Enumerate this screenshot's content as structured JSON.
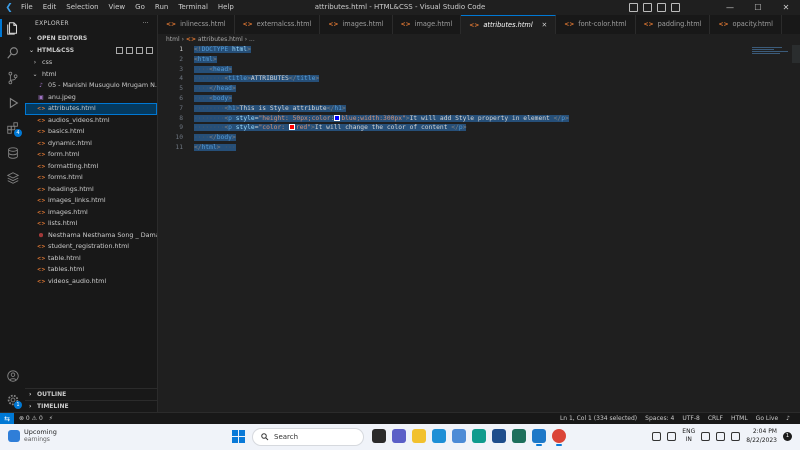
{
  "window": {
    "title": "attributes.html - HTML&CSS - Visual Studio Code",
    "menu": [
      "File",
      "Edit",
      "Selection",
      "View",
      "Go",
      "Run",
      "Terminal",
      "Help"
    ],
    "controls": {
      "minimize": "—",
      "maximize": "☐",
      "close": "✕"
    }
  },
  "sidebar": {
    "header": "EXPLORER",
    "more": "···",
    "open_editors": "OPEN EDITORS",
    "workspace": "HTML&CSS",
    "tree": [
      {
        "label": "css",
        "kind": "folder",
        "chevron": "›",
        "indent": 1
      },
      {
        "label": "html",
        "kind": "folder",
        "chevron": "⌄",
        "indent": 1
      },
      {
        "label": "05 - Manishi Musugulo Mrugam N...",
        "kind": "audio",
        "indent": 2
      },
      {
        "label": "anu.jpeg",
        "kind": "img",
        "indent": 2
      },
      {
        "label": "attributes.html",
        "kind": "html",
        "indent": 2,
        "selected": true
      },
      {
        "label": "audios_videos.html",
        "kind": "html",
        "indent": 2
      },
      {
        "label": "basics.html",
        "kind": "html",
        "indent": 2
      },
      {
        "label": "dynamic.html",
        "kind": "html",
        "indent": 2
      },
      {
        "label": "form.html",
        "kind": "html",
        "indent": 2
      },
      {
        "label": "formatting.html",
        "kind": "html",
        "indent": 2
      },
      {
        "label": "forms.html",
        "kind": "html",
        "indent": 2
      },
      {
        "label": "headings.html",
        "kind": "html",
        "indent": 2
      },
      {
        "label": "images_links.html",
        "kind": "html",
        "indent": 2
      },
      {
        "label": "images.html",
        "kind": "html",
        "indent": 2
      },
      {
        "label": "lists.html",
        "kind": "html",
        "indent": 2
      },
      {
        "label": "Nesthama Nesthama Song _ Damar...",
        "kind": "err",
        "indent": 2
      },
      {
        "label": "student_registration.html",
        "kind": "html",
        "indent": 2
      },
      {
        "label": "table.html",
        "kind": "html",
        "indent": 2
      },
      {
        "label": "tables.html",
        "kind": "html",
        "indent": 2
      },
      {
        "label": "videos_audio.html",
        "kind": "html",
        "indent": 2
      }
    ],
    "outline": "OUTLINE",
    "timeline": "TIMELINE"
  },
  "tabs": [
    {
      "label": "inlinecss.html"
    },
    {
      "label": "externalcss.html"
    },
    {
      "label": "images.html"
    },
    {
      "label": "image.html"
    },
    {
      "label": "attributes.html",
      "active": true,
      "close": "✕"
    },
    {
      "label": "font-color.html"
    },
    {
      "label": "padding.html"
    },
    {
      "label": "opacity.html"
    }
  ],
  "breadcrumb": {
    "folder": "html",
    "sep": "›",
    "icon": "<>",
    "file": "attributes.html",
    "tail": "› ..."
  },
  "editor": {
    "line_numbers": [
      "1",
      "2",
      "3",
      "4",
      "5",
      "6",
      "7",
      "8",
      "9",
      "10",
      "11"
    ],
    "current_line": 1,
    "swatches": {
      "blue": "#0000ff",
      "red": "#ff0000"
    }
  },
  "statusbar": {
    "errors": "⊗ 0 ⚠ 0",
    "ports": "⚡",
    "position": "Ln 1, Col 1 (334 selected)",
    "spaces": "Spaces: 4",
    "encoding": "UTF-8",
    "eol": "CRLF",
    "language": "HTML",
    "golive": "Go Live",
    "bell": "♪"
  },
  "taskbar": {
    "weather_title": "Upcoming",
    "weather_sub": "earnings",
    "search_placeholder": "Search",
    "lang_top": "ENG",
    "lang_bottom": "IN",
    "time": "2:04 PM",
    "date": "8/22/2023",
    "notifications": "1"
  },
  "colors": {
    "accent": "#0078d4",
    "selection": "#264f78",
    "tag": "#569cd6",
    "attr": "#9cdcfe",
    "string": "#ce9178"
  }
}
